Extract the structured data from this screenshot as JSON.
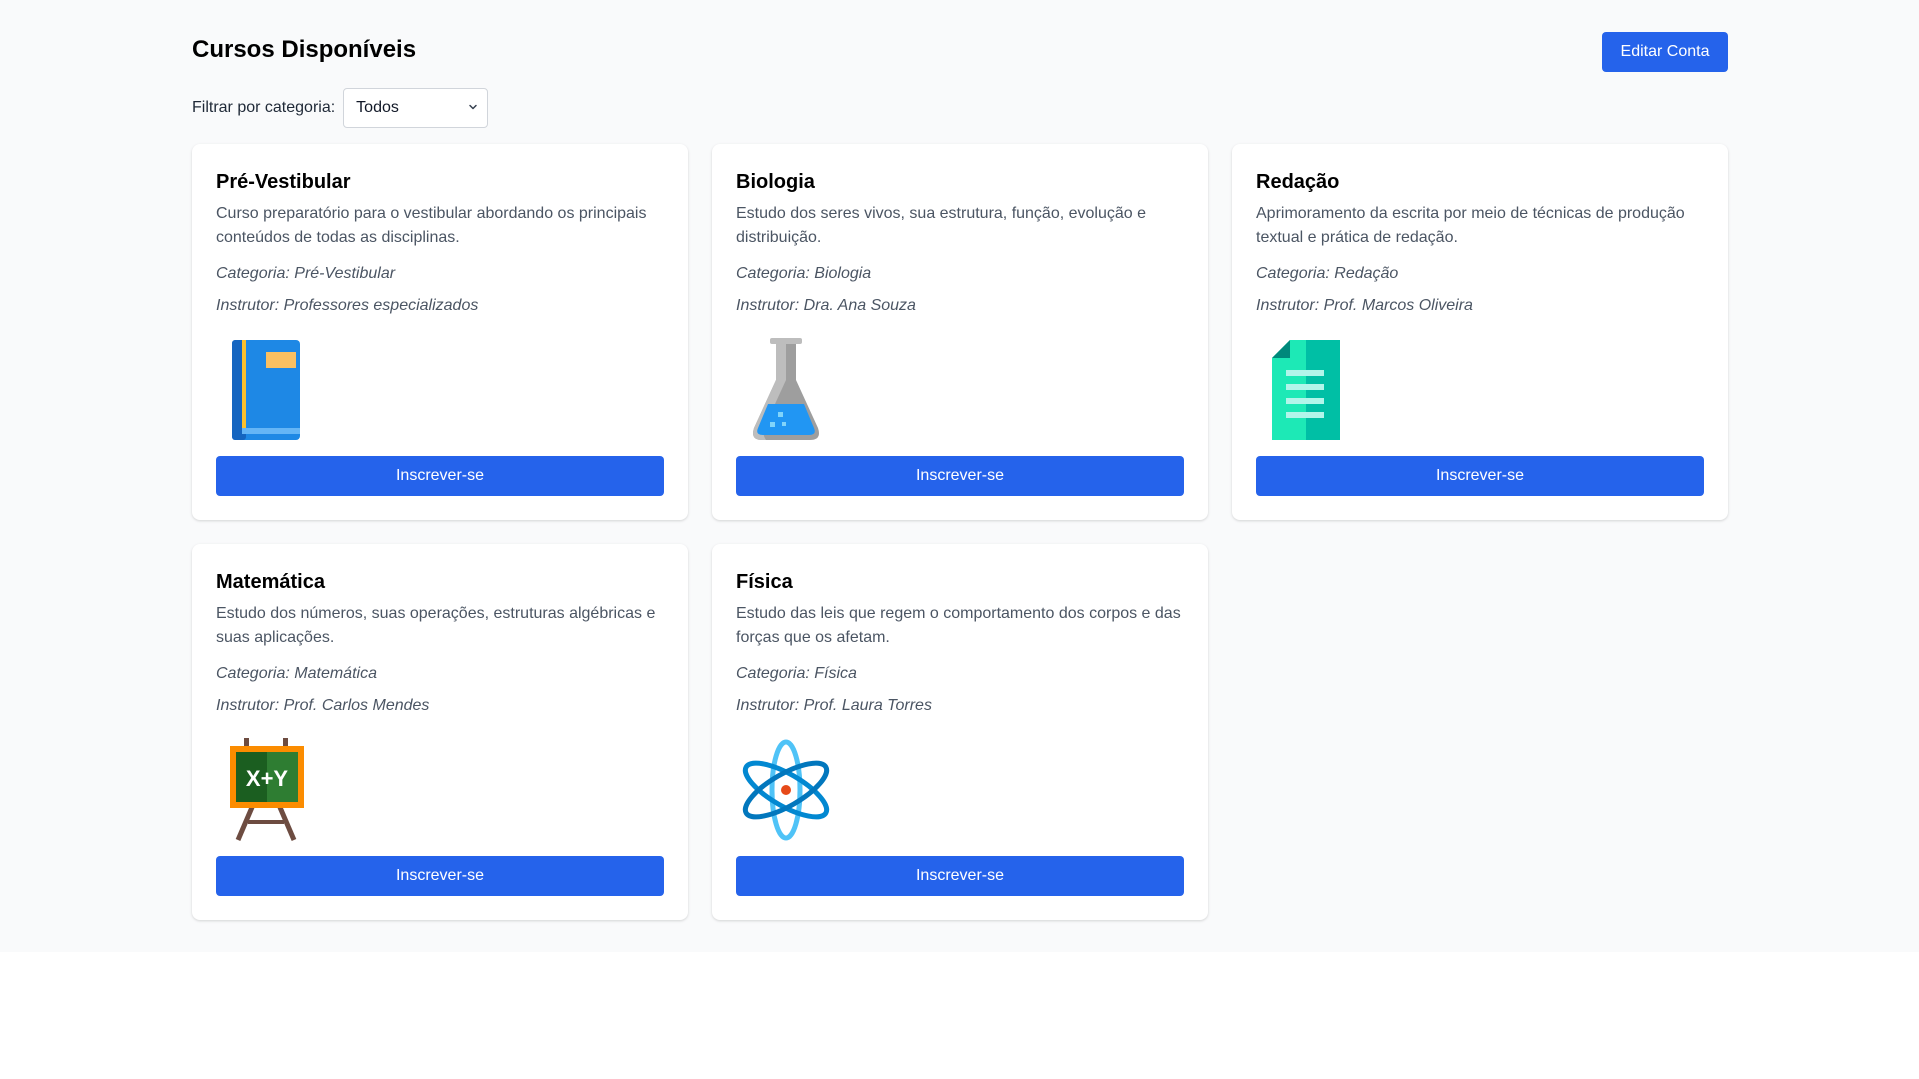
{
  "header": {
    "title": "Cursos Disponíveis",
    "edit_account_label": "Editar Conta"
  },
  "filter": {
    "label": "Filtrar por categoria:",
    "selected": "Todos"
  },
  "courses": [
    {
      "title": "Pré-Vestibular",
      "description": "Curso preparatório para o vestibular abordando os principais conteúdos de todas as disciplinas.",
      "category": "Categoria: Pré-Vestibular",
      "instructor": "Instrutor: Professores especializados",
      "icon": "book-icon",
      "button_label": "Inscrever-se"
    },
    {
      "title": "Biologia",
      "description": "Estudo dos seres vivos, sua estrutura, função, evolução e distribuição.",
      "category": "Categoria: Biologia",
      "instructor": "Instrutor: Dra. Ana Souza",
      "icon": "flask-icon",
      "button_label": "Inscrever-se"
    },
    {
      "title": "Redação",
      "description": "Aprimoramento da escrita por meio de técnicas de produção textual e prática de redação.",
      "category": "Categoria: Redação",
      "instructor": "Instrutor: Prof. Marcos Oliveira",
      "icon": "document-icon",
      "button_label": "Inscrever-se"
    },
    {
      "title": "Matemática",
      "description": "Estudo dos números, suas operações, estruturas algébricas e suas aplicações.",
      "category": "Categoria: Matemática",
      "instructor": "Instrutor: Prof. Carlos Mendes",
      "icon": "chalkboard-icon",
      "icon_text": "X+Y",
      "button_label": "Inscrever-se"
    },
    {
      "title": "Física",
      "description": "Estudo das leis que regem o comportamento dos corpos e das forças que os afetam.",
      "category": "Categoria: Física",
      "instructor": "Instrutor: Prof. Laura Torres",
      "icon": "atom-icon",
      "button_label": "Inscrever-se"
    }
  ],
  "colors": {
    "primary": "#2563eb",
    "page_background": "#f9fafb"
  }
}
